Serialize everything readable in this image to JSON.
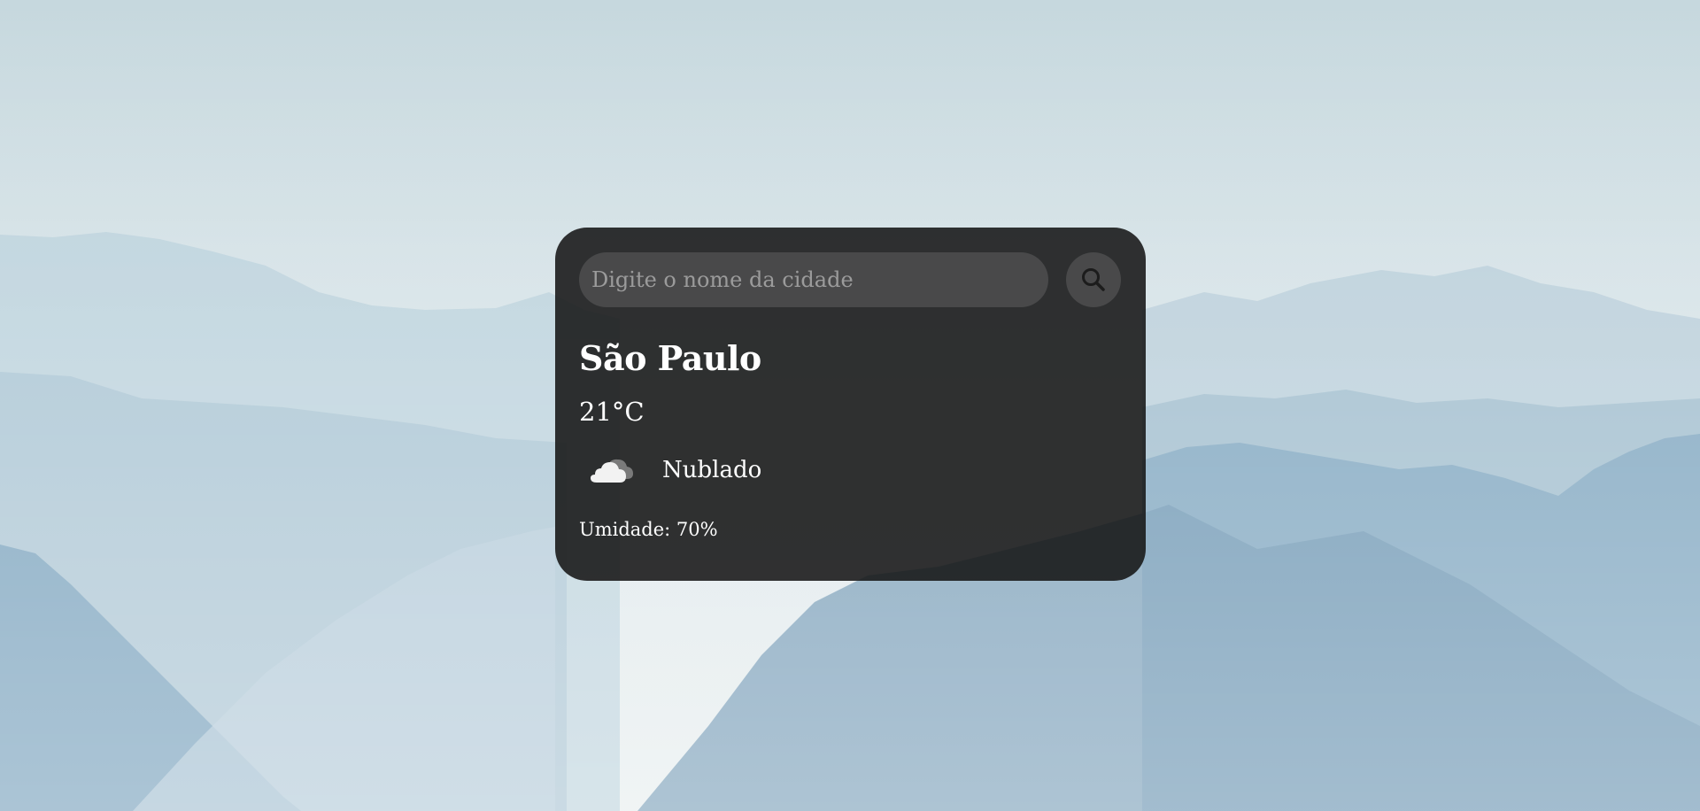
{
  "search": {
    "placeholder": "Digite o nome da cidade",
    "value": "",
    "icon": "search-icon"
  },
  "weather": {
    "city": "São Paulo",
    "temperature": "21°C",
    "description": "Nublado",
    "icon": "cloud-icon",
    "humidity_label": "Umidade: 70%"
  },
  "colors": {
    "card_background": "#161616",
    "text": "#ffffff",
    "input_background": "#3a3a3a",
    "sky": "#d4e1e6",
    "mountains": "#5f8faf"
  }
}
